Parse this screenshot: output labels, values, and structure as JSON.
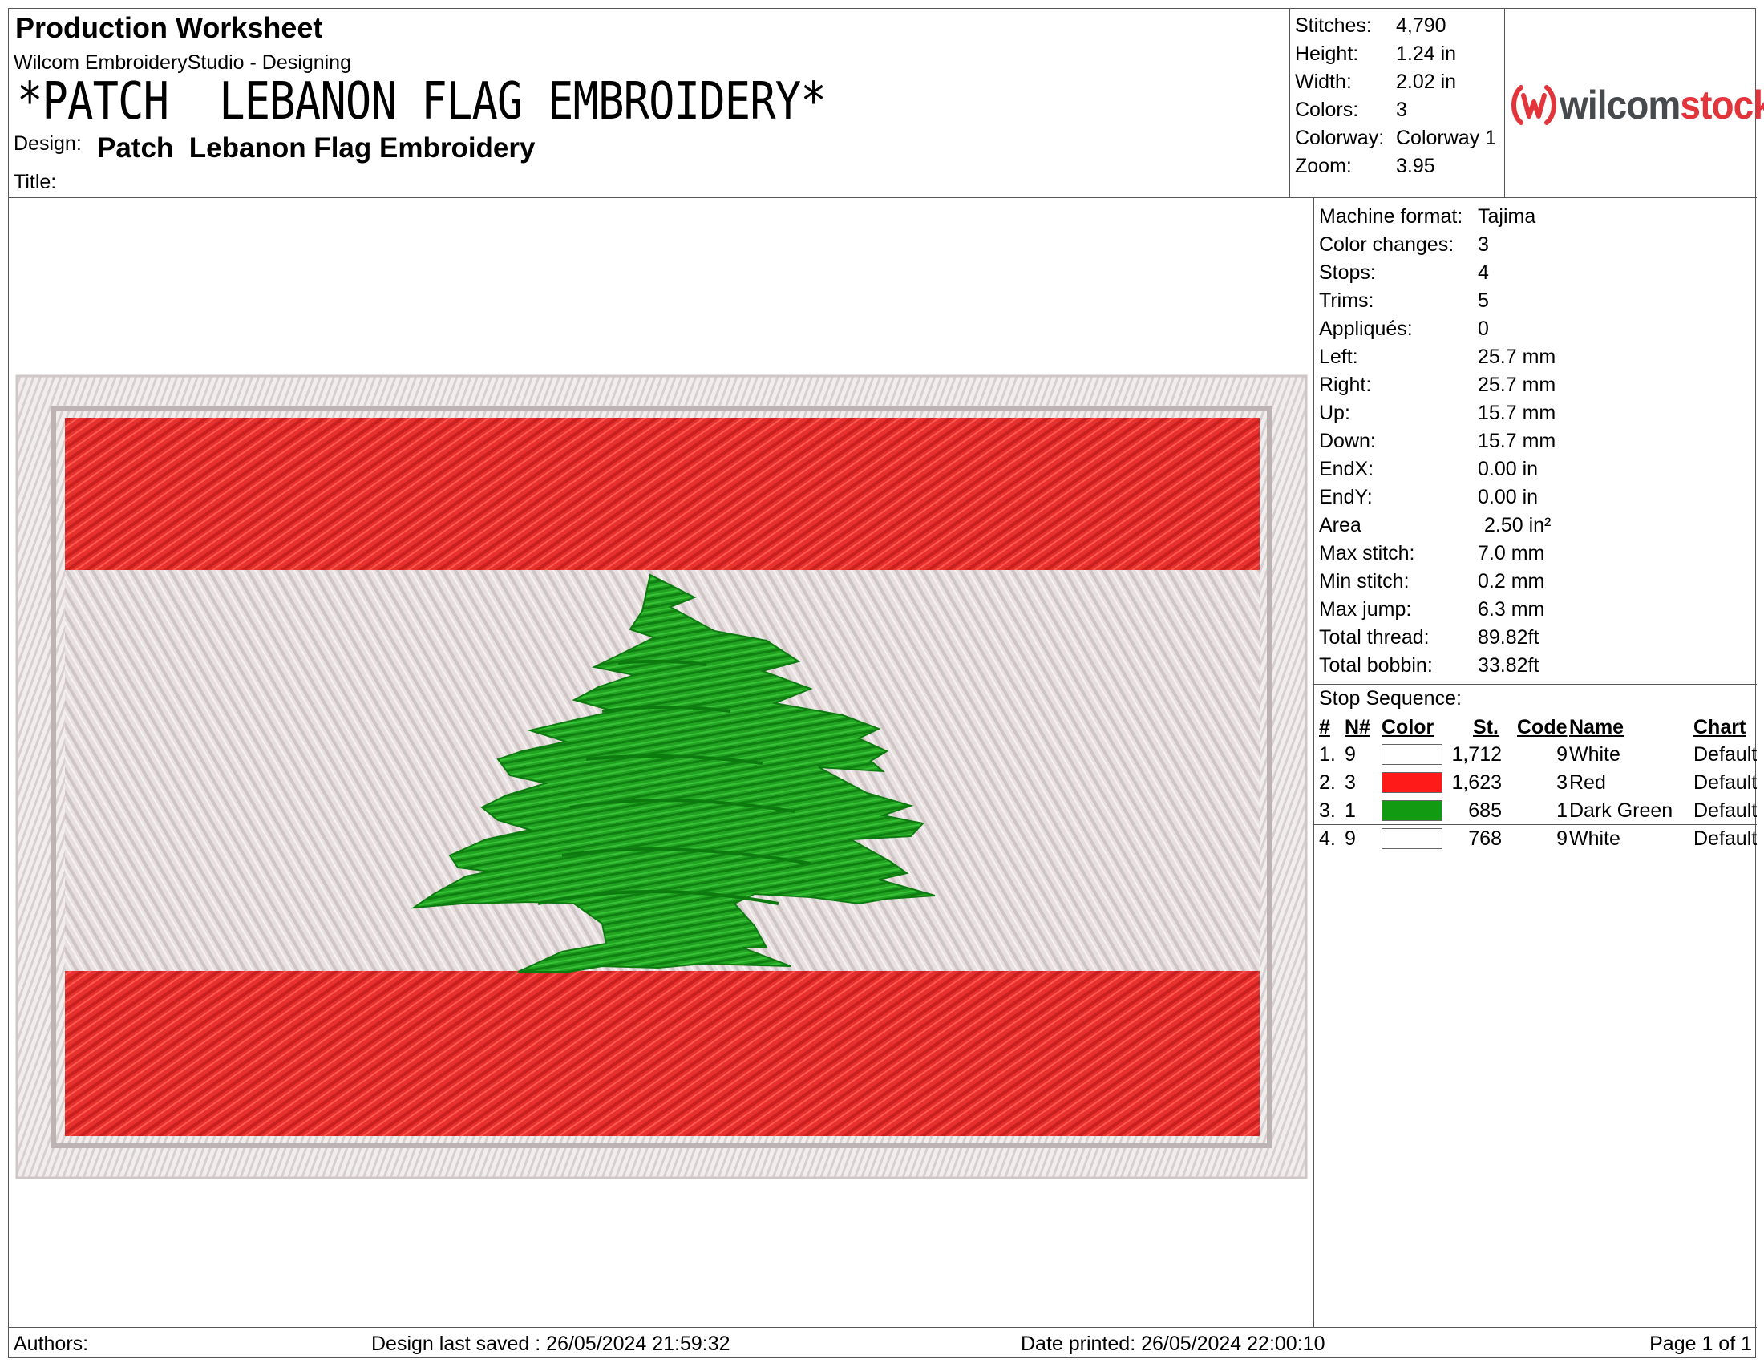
{
  "header": {
    "title": "Production Worksheet",
    "subtitle": "Wilcom EmbroideryStudio - Designing",
    "design_banner": "*PATCH  LEBANON FLAG EMBROIDERY*",
    "design_label": "Design:",
    "design_value": "Patch  Lebanon Flag Embroidery",
    "title_label": "Title:",
    "title_value": ""
  },
  "summary": [
    {
      "label": "Stitches:",
      "value": "4,790"
    },
    {
      "label": "Height:",
      "value": "1.24 in"
    },
    {
      "label": "Width:",
      "value": "2.02 in"
    },
    {
      "label": "Colors:",
      "value": "3"
    },
    {
      "label": "Colorway:",
      "value": "Colorway 1"
    },
    {
      "label": "Zoom:",
      "value": "3.95"
    }
  ],
  "logo": {
    "word_dark": "wilcom",
    "word_red": "stock",
    "mark_icon": "wilcom-logo-icon",
    "colors": {
      "dark": "#474a4d",
      "red": "#e2353b"
    }
  },
  "specs": [
    {
      "label": "Machine format:",
      "value": "Tajima"
    },
    {
      "label": "Color changes:",
      "value": "3"
    },
    {
      "label": "Stops:",
      "value": "4"
    },
    {
      "label": "Trims:",
      "value": "5"
    },
    {
      "label": "Appliqués:",
      "value": "0"
    },
    {
      "label": "Left:",
      "value": "25.7 mm"
    },
    {
      "label": "Right:",
      "value": "25.7 mm"
    },
    {
      "label": "Up:",
      "value": "15.7 mm"
    },
    {
      "label": "Down:",
      "value": "15.7 mm"
    },
    {
      "label": "EndX:",
      "value": "0.00 in"
    },
    {
      "label": "EndY:",
      "value": "0.00 in"
    },
    {
      "label": "Area",
      "value": "2.50 in²"
    },
    {
      "label": "Max stitch:",
      "value": "7.0 mm"
    },
    {
      "label": "Min stitch:",
      "value": "0.2 mm"
    },
    {
      "label": "Max jump:",
      "value": "6.3 mm"
    },
    {
      "label": "Total thread:",
      "value": "89.82ft"
    },
    {
      "label": "Total bobbin:",
      "value": "33.82ft"
    }
  ],
  "stop_sequence": {
    "title": "Stop Sequence:",
    "headers": {
      "num": "#",
      "needle": "N#",
      "color": "Color",
      "stitches": "St.",
      "code": "Code",
      "name": "Name",
      "chart": "Chart"
    },
    "rows": [
      {
        "num": "1.",
        "needle": "9",
        "swatch": "#ffffff",
        "stitches": "1,712",
        "code": "9",
        "name": "White",
        "chart": "Default"
      },
      {
        "num": "2.",
        "needle": "3",
        "swatch": "#ff1a1a",
        "stitches": "1,623",
        "code": "3",
        "name": "Red",
        "chart": "Default"
      },
      {
        "num": "3.",
        "needle": "1",
        "swatch": "#129a12",
        "stitches": "685",
        "code": "1",
        "name": "Dark Green",
        "chart": "Default"
      },
      {
        "num": "4.",
        "needle": "9",
        "swatch": "#ffffff",
        "stitches": "768",
        "code": "9",
        "name": "White",
        "chart": "Default"
      }
    ]
  },
  "footer": {
    "authors": "Authors:",
    "last_saved": "Design last saved : 26/05/2024 21:59:32",
    "printed": "Date printed: 26/05/2024 22:00:10",
    "page": "Page 1 of 1"
  },
  "design_colors": {
    "border_white": "#f2eded",
    "field_white": "#e6dede",
    "red": "#e8302e",
    "green": "#1f9d1f"
  }
}
